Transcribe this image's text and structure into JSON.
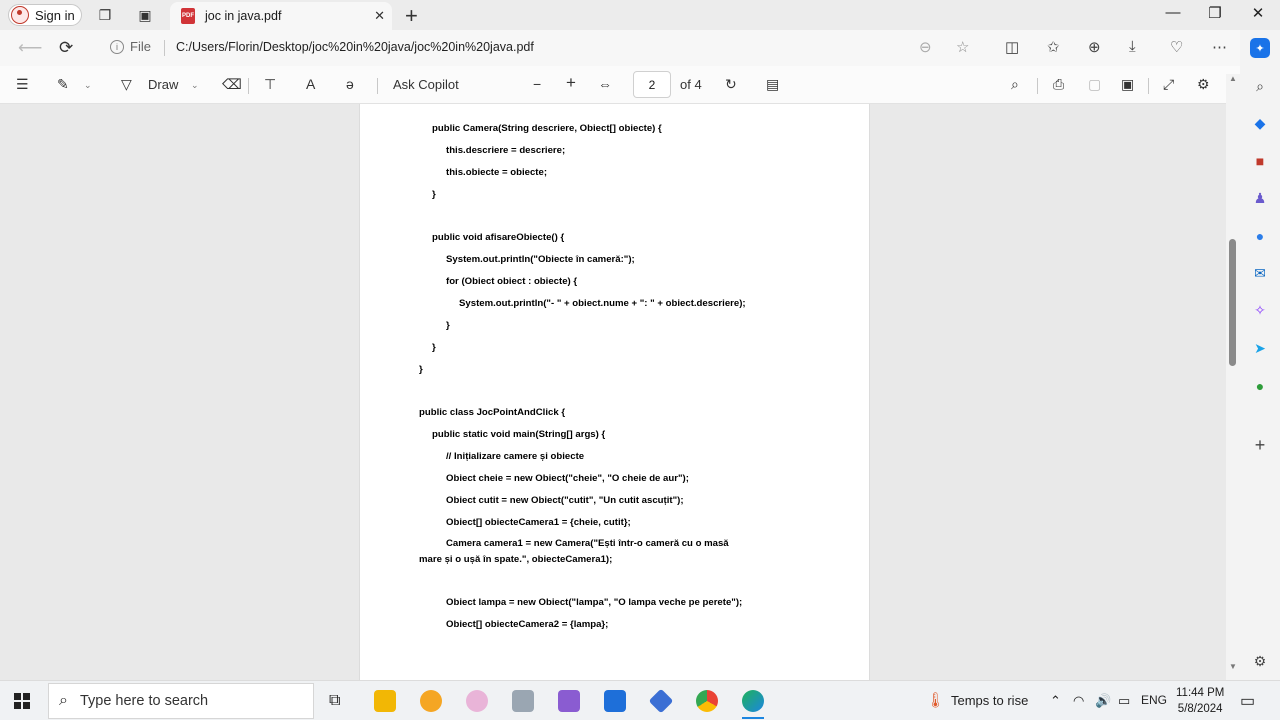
{
  "browser": {
    "signin_label": "Sign in",
    "tab_title": "joc in java.pdf",
    "file_label": "File",
    "url": "C:/Users/Florin/Desktop/joc%20in%20java/joc%20in%20java.pdf"
  },
  "pdf_toolbar": {
    "draw_label": "Draw",
    "ask_copilot_label": "Ask Copilot",
    "page_number": "2",
    "page_total": "of 4",
    "zoom_out": "−",
    "zoom_in": "+"
  },
  "document": {
    "lines": [
      "public Camera(String descriere, Obiect[] obiecte) {",
      "this.descriere = descriere;",
      "this.obiecte = obiecte;",
      "}",
      "public void afisareObiecte() {",
      "System.out.println(\"Obiecte în cameră:\");",
      "for (Obiect obiect : obiecte) {",
      "System.out.println(\"- \" + obiect.nume + \": \" + obiect.descriere);",
      "}",
      "}",
      "}",
      "public class JocPointAndClick {",
      "public static void main(String[] args) {",
      "// Inițializare camere și obiecte",
      "Obiect cheie = new Obiect(\"cheie\", \"O cheie de aur\");",
      "Obiect cutit = new Obiect(\"cutit\", \"Un cutit ascuțit\");",
      "Obiect[] obiecteCamera1 = {cheie, cutit};",
      "Camera camera1 = new Camera(\"Ești într-o cameră cu o masă",
      "mare și o ușă în spate.\", obiecteCamera1);",
      "Obiect lampa = new Obiect(\"lampa\", \"O lampa veche pe perete\");",
      "Obiect[] obiecteCamera2 = {lampa};"
    ]
  },
  "taskbar": {
    "search_placeholder": "Type here to search",
    "weather_label": "Temps to rise",
    "language": "ENG",
    "time": "11:44 PM",
    "date": "5/8/2024"
  }
}
